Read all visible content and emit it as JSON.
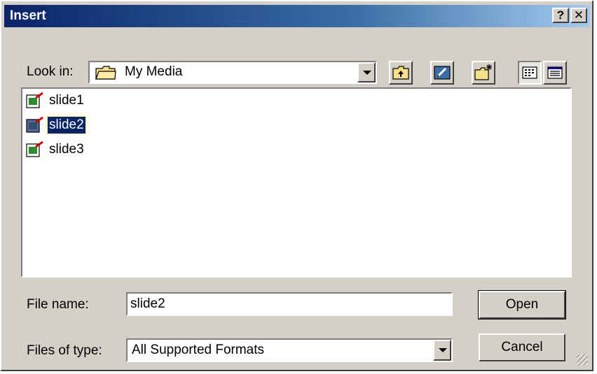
{
  "window": {
    "title": "Insert",
    "help_label": "?",
    "close_label": "✕"
  },
  "look_in": {
    "label": "Look in:",
    "value": "My Media"
  },
  "toolbar": {
    "buttons": [
      "up-one-level-icon",
      "desktop-icon",
      "new-folder-icon",
      "list-view-icon",
      "details-view-icon"
    ]
  },
  "files": [
    {
      "name": "slide1",
      "selected": false
    },
    {
      "name": "slide2",
      "selected": true
    },
    {
      "name": "slide3",
      "selected": false
    }
  ],
  "file_name": {
    "label": "File name:",
    "value": "slide2"
  },
  "file_type": {
    "label": "Files of type:",
    "value": "All Supported Formats"
  },
  "buttons": {
    "open_label": "Open",
    "cancel_label": "Cancel"
  },
  "colors": {
    "title_start": "#0a246a",
    "title_end": "#a6caf0",
    "face": "#d4d0c8",
    "selection": "#0a246a"
  }
}
